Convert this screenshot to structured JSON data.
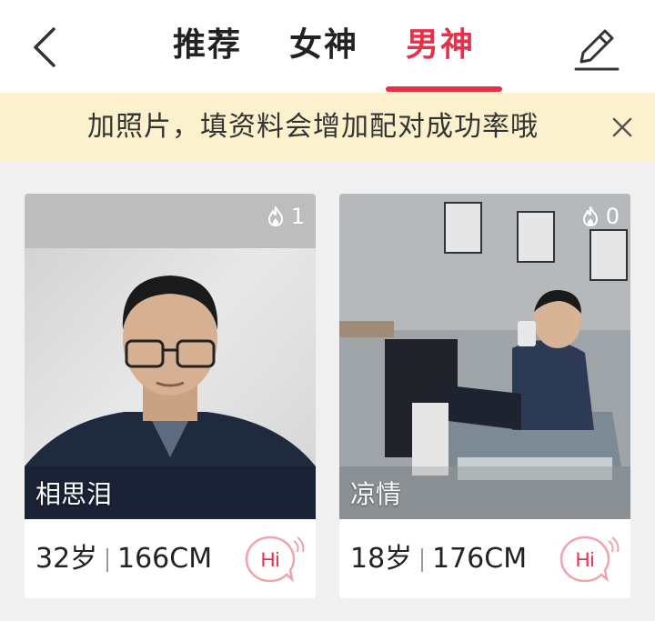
{
  "header": {
    "back_icon": "chevron-left-icon",
    "tabs": [
      {
        "label": "推荐"
      },
      {
        "label": "女神"
      },
      {
        "label": "男神"
      }
    ],
    "active_tab": "男神",
    "edit_icon": "pencil-icon",
    "accent_color": "#e8304a"
  },
  "banner": {
    "text": "加照片，填资料会增加配对成功率哦",
    "close_icon": "close-icon",
    "background": "#fbf1cd"
  },
  "cards": [
    {
      "name": "相思泪",
      "age": "32岁",
      "height": "166CM",
      "heat": "1",
      "hi_label": "Hi"
    },
    {
      "name": "凉情",
      "age": "18岁",
      "height": "176CM",
      "heat": "0",
      "hi_label": "Hi"
    }
  ]
}
